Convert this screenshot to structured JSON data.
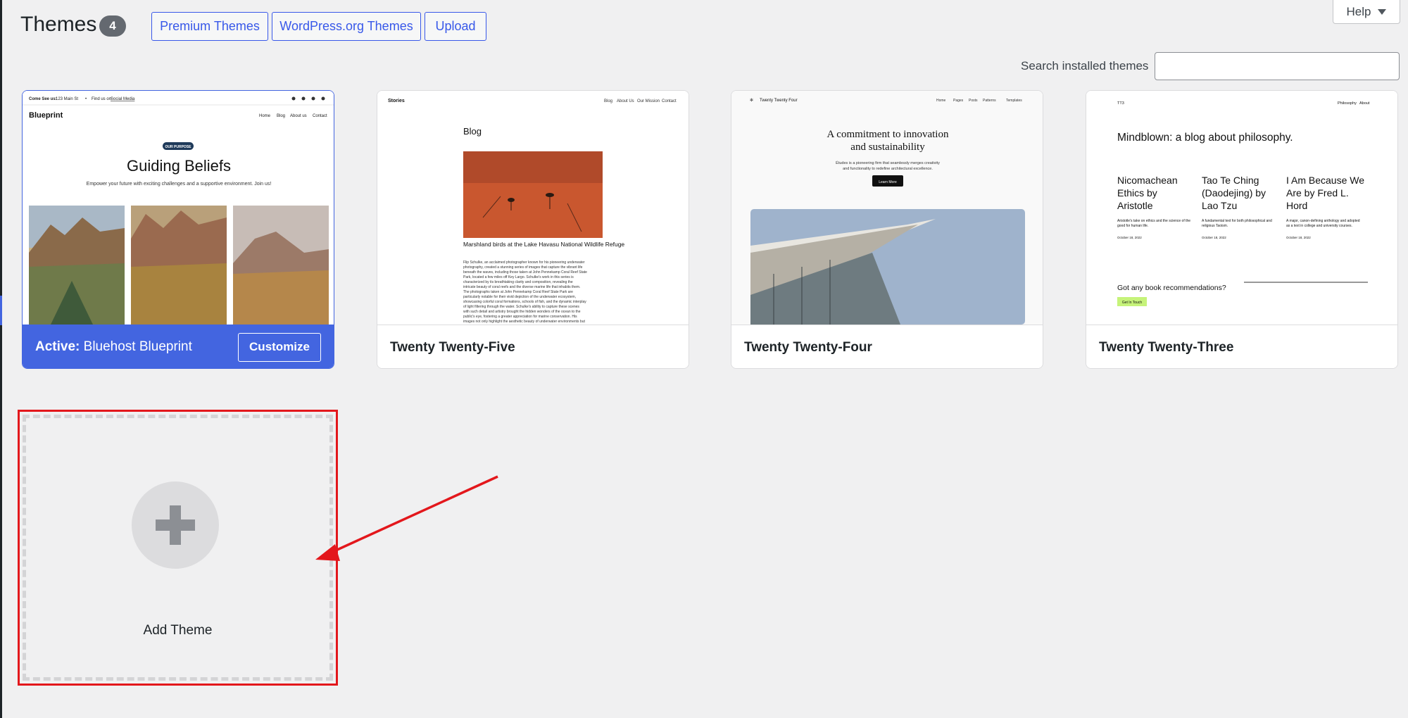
{
  "header": {
    "title": "Themes",
    "count": "4",
    "buttons": [
      "Premium Themes",
      "WordPress.org Themes",
      "Upload"
    ],
    "help_label": "Help"
  },
  "search": {
    "label": "Search installed themes",
    "value": "",
    "placeholder": ""
  },
  "themes": [
    {
      "active_prefix": "Active:",
      "name": "Bluehost Blueprint",
      "action": "Customize",
      "preview": {
        "topbar_left": "Come See us:",
        "topbar_address": "123 Main St",
        "topbar_find": "Find us on",
        "topbar_link": "Social Media",
        "site_title": "Blueprint",
        "nav": [
          "Home",
          "Blog",
          "About us",
          "Contact"
        ],
        "badge": "OUR PURPOSE",
        "heading": "Guiding Beliefs",
        "tagline": "Empower your future with exciting challenges and a supportive environment. Join us!"
      }
    },
    {
      "name": "Twenty Twenty-Five",
      "preview": {
        "site_title": "Stories",
        "nav": [
          "Blog",
          "About Us",
          "Our Mission",
          "Contact"
        ],
        "heading": "Blog",
        "caption": "Marshland birds at the Lake Havasu National Wildlife Refuge",
        "body": [
          "Flip Schulke, an acclaimed photographer known for his pioneering underwater",
          "photography, created a stunning series of images that capture the vibrant life",
          "beneath the waves, including those taken at John Pennekamp Coral Reef State",
          "Park, located a few miles off Key Largo. Schulke's work in this series is",
          "characterized by its breathtaking clarity and composition, revealing the",
          "intricate beauty of coral reefs and the diverse marine life that inhabits them.",
          "The photographs taken at John Pennekamp Coral Reef State Park are",
          "particularly notable for their vivid depiction of the underwater ecosystem,",
          "showcasing colorful coral formations, schools of fish, and the dynamic interplay",
          "of light filtering through the water. Schulke's ability to capture these scenes",
          "with such detail and artistry brought the hidden wonders of the ocean to the",
          "public's eye, fostering a greater appreciation for marine conservation. His",
          "images not only highlight the aesthetic beauty of underwater environments but"
        ]
      }
    },
    {
      "name": "Twenty Twenty-Four",
      "preview": {
        "site_title": "Twenty Twenty Four",
        "nav": [
          "Home",
          "Pages",
          "Posts",
          "Patterns",
          "Templates"
        ],
        "heading_line1": "A commitment to innovation",
        "heading_line2": "and sustainability",
        "sub_line1": "Études is a pioneering firm that seamlessly merges creativity",
        "sub_line2": "and functionality to redefine architectural excellence.",
        "button": "Learn More"
      }
    },
    {
      "name": "Twenty Twenty-Three",
      "preview": {
        "site_title": "TT3",
        "nav": [
          "Philosophy",
          "About"
        ],
        "heading": "Mindblown: a blog about philosophy.",
        "posts": [
          {
            "title_lines": [
              "Nicomachean",
              "Ethics by",
              "Aristotle"
            ],
            "excerpt_lines": [
              "Aristotle's take on ethics and the science of the",
              "good for human life."
            ],
            "date": "October 18, 2022"
          },
          {
            "title_lines": [
              "Tao Te Ching",
              "(Daodejing) by",
              "Lao Tzu"
            ],
            "excerpt_lines": [
              "A fundamental text for both philosophical and",
              "religious Taoism."
            ],
            "date": "October 18, 2022"
          },
          {
            "title_lines": [
              "I Am Because We",
              "Are by Fred L.",
              "Hord"
            ],
            "excerpt_lines": [
              "A major, canon-defining anthology and adopted",
              "as a text in college and university courses."
            ],
            "date": "October 18, 2022"
          }
        ],
        "cta": "Got any book recommendations?",
        "cta_button": "Get In Touch"
      }
    }
  ],
  "add_theme": {
    "label": "Add Theme"
  },
  "colors": {
    "accent": "#4365e0",
    "annotation": "#e3171c",
    "background": "#f0f0f1"
  }
}
